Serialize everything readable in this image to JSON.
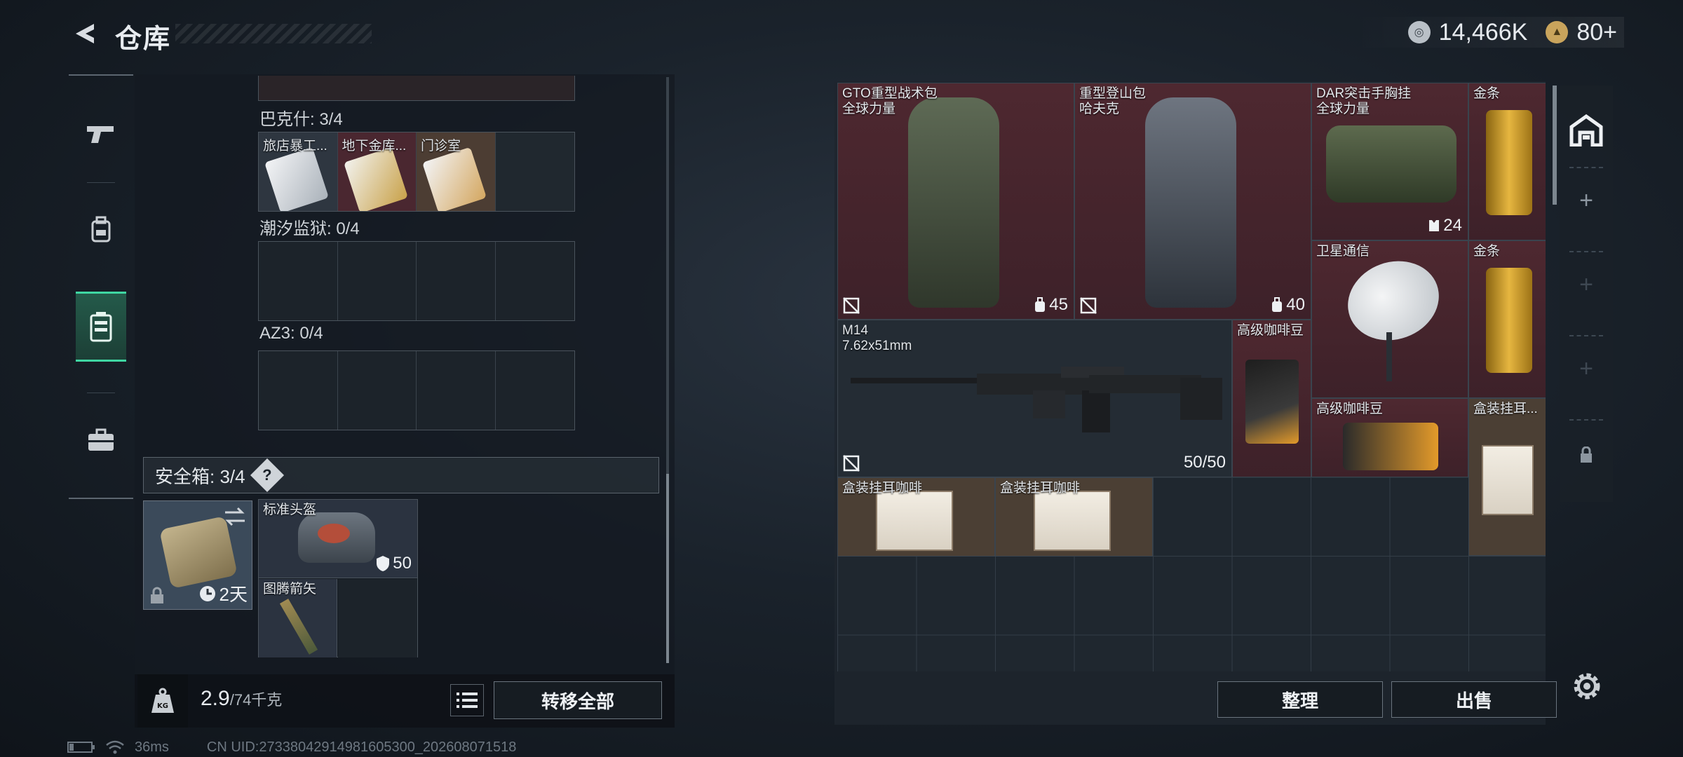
{
  "header": {
    "title": "仓库",
    "currency": [
      {
        "icon": "silver-coin-icon",
        "value": "14,466K"
      },
      {
        "icon": "gold-coin-icon",
        "value": "80+"
      }
    ]
  },
  "left_tabs": [
    {
      "icon": "gun-icon",
      "active": false
    },
    {
      "icon": "backpack-icon",
      "active": false
    },
    {
      "icon": "container-icon",
      "active": true
    },
    {
      "icon": "briefcase-icon",
      "active": false
    }
  ],
  "stash": {
    "sections": [
      {
        "label": "巴克什: 3/4",
        "items": [
          "旅店暴工...",
          "地下金库...",
          "门诊室",
          ""
        ]
      },
      {
        "label": "潮汐监狱: 0/4",
        "items": [
          "",
          "",
          "",
          ""
        ]
      },
      {
        "label": "AZ3: 0/4",
        "items": [
          "",
          "",
          "",
          ""
        ]
      }
    ],
    "safebox": {
      "label": "安全箱: 3/4",
      "help": "?",
      "duration": "2天",
      "items": [
        {
          "name": "标准头盔",
          "stat": "50"
        },
        {
          "name": "图腾箭矢"
        }
      ]
    },
    "weight": {
      "current": "2.9",
      "max": "/74千克"
    },
    "transfer_label": "转移全部",
    "kg_badge": "KG"
  },
  "inventory": {
    "items": [
      {
        "name": "GTO重型战术包",
        "sub": "全球力量",
        "stat": "45"
      },
      {
        "name": "重型登山包",
        "sub": "哈夫克",
        "stat": "40"
      },
      {
        "name": "DAR突击手胸挂",
        "sub": "全球力量",
        "stat": "24"
      },
      {
        "name": "金条"
      },
      {
        "name": "卫星通信"
      },
      {
        "name": "金条"
      },
      {
        "name": "M14",
        "sub": "7.62x51mm",
        "stat": "50/50"
      },
      {
        "name": "高级咖啡豆"
      },
      {
        "name": "高级咖啡豆"
      },
      {
        "name": "盒装挂耳..."
      },
      {
        "name": "盒装挂耳咖啡"
      },
      {
        "name": "盒装挂耳咖啡"
      }
    ],
    "sort_label": "整理",
    "sell_label": "出售"
  },
  "status": {
    "ping": "36ms",
    "uid": "CN UID:27338042914981605300_202608071518"
  }
}
